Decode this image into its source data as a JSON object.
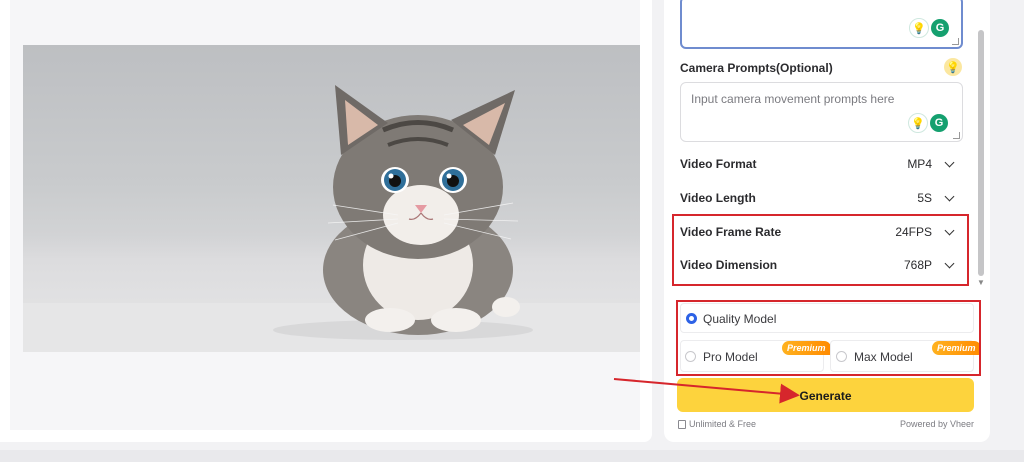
{
  "camera_prompts": {
    "label": "Camera Prompts(Optional)",
    "placeholder": "Input camera movement prompts here",
    "idea_icon": "lightbulb-icon"
  },
  "settings": [
    {
      "label": "Video Format",
      "value": "MP4"
    },
    {
      "label": "Video Length",
      "value": "5S"
    },
    {
      "label": "Video Frame Rate",
      "value": "24FPS"
    },
    {
      "label": "Video Dimension",
      "value": "768P"
    }
  ],
  "models": {
    "quality": {
      "label": "Quality Model",
      "selected": true
    },
    "pro": {
      "label": "Pro Model",
      "badge": "Premium",
      "selected": false
    },
    "max": {
      "label": "Max Model",
      "badge": "Premium",
      "selected": false
    }
  },
  "generate_label": "Generate",
  "footer": {
    "left": "Unlimited & Free",
    "right": "Powered by Vheer"
  },
  "colors": {
    "accent_yellow": "#fdd33d",
    "annotation_red": "#d6262c",
    "radio_blue": "#2d62e6",
    "premium_orange": "#ff9a10"
  }
}
